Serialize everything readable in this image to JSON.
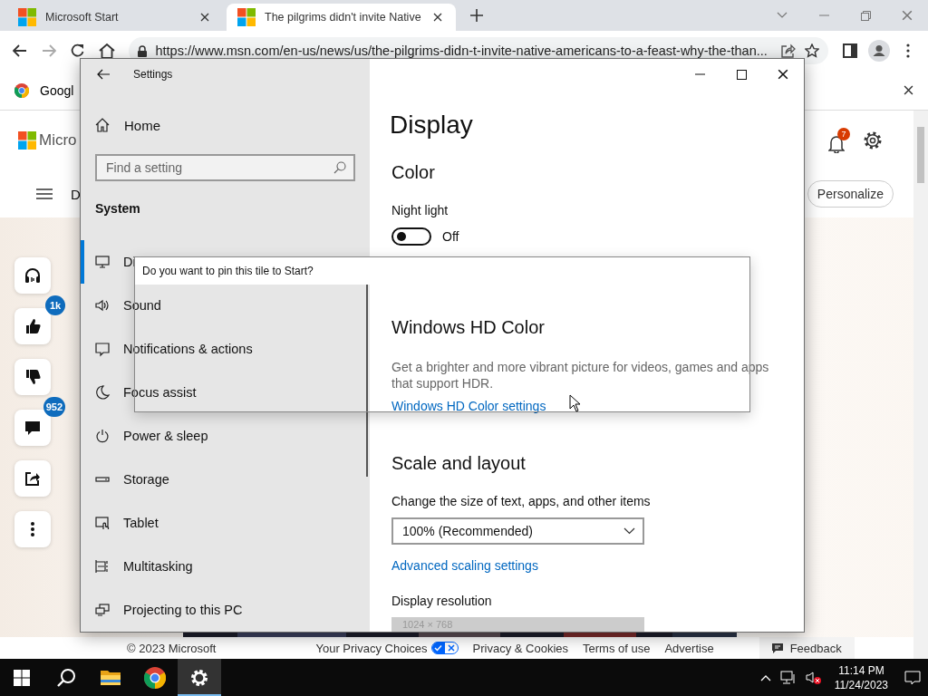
{
  "browser": {
    "tabs": [
      {
        "title": "Microsoft Start",
        "selected": false
      },
      {
        "title": "The pilgrims didn't invite Native",
        "selected": true
      }
    ],
    "url": "https://www.msn.com/en-us/news/us/the-pilgrims-didn-t-invite-native-americans-to-a-feast-why-the-than...",
    "bookmarks": [
      {
        "label": "Googl"
      }
    ]
  },
  "page": {
    "logo_text": "Micro",
    "nav_text": "D",
    "notification_count": "7",
    "personalize": "Personalize",
    "side_actions": [
      {
        "kind": "listen"
      },
      {
        "kind": "like",
        "badge": "1k"
      },
      {
        "kind": "dislike"
      },
      {
        "kind": "comment",
        "badge": "952"
      },
      {
        "kind": "share"
      },
      {
        "kind": "more"
      }
    ],
    "footer": {
      "copyright": "© 2023 Microsoft",
      "privacy_choices": "Your Privacy Choices",
      "links": [
        "Privacy & Cookies",
        "Terms of use",
        "Advertise"
      ],
      "feedback": "Feedback"
    }
  },
  "settings": {
    "title": "Settings",
    "home": "Home",
    "search": {
      "placeholder": "Find a setting"
    },
    "section": "System",
    "nav": [
      {
        "label": "Di",
        "kind": "display",
        "selected": true
      },
      {
        "label": "Sound",
        "kind": "sound",
        "selected": false
      },
      {
        "label": "Notifications & actions",
        "kind": "notifications",
        "selected": false
      },
      {
        "label": "Focus assist",
        "kind": "focus",
        "selected": false
      },
      {
        "label": "Power & sleep",
        "kind": "power",
        "selected": false
      },
      {
        "label": "Storage",
        "kind": "storage",
        "selected": false
      },
      {
        "label": "Tablet",
        "kind": "tablet",
        "selected": false
      },
      {
        "label": "Multitasking",
        "kind": "multitasking",
        "selected": false
      },
      {
        "label": "Projecting to this PC",
        "kind": "projecting",
        "selected": false
      }
    ],
    "page_title": "Display",
    "color": {
      "heading": "Color",
      "night_light": {
        "label": "Night light",
        "on": false,
        "state_text": "Off"
      }
    },
    "hd_color": {
      "heading": "Windows HD Color",
      "description": "Get a brighter and more vibrant picture for videos, games and apps that support HDR.",
      "link": "Windows HD Color settings"
    },
    "scale": {
      "heading": "Scale and layout",
      "size_label": "Change the size of text, apps, and other items",
      "size_value": "100% (Recommended)",
      "advanced_link": "Advanced scaling settings",
      "resolution_label": "Display resolution",
      "resolution_value": "1024 × 768"
    }
  },
  "dialog": {
    "title": "Do you want to pin this tile to Start?"
  },
  "taskbar": {
    "apps": [
      {
        "kind": "start",
        "selected": false
      },
      {
        "kind": "search",
        "selected": false
      },
      {
        "kind": "files",
        "selected": false
      },
      {
        "kind": "chrome",
        "selected": false
      },
      {
        "kind": "settings",
        "selected": true
      }
    ],
    "time": "11:14 PM",
    "date": "11/24/2023"
  }
}
